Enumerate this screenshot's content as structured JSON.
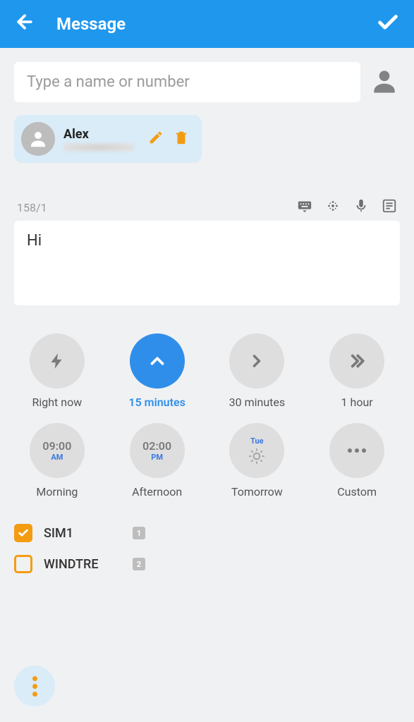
{
  "header": {
    "title": "Message"
  },
  "recipient": {
    "placeholder": "Type a name or number"
  },
  "contact": {
    "name": "Alex"
  },
  "message": {
    "counter": "158/1",
    "body": "Hi"
  },
  "schedule": [
    {
      "label": "Right now"
    },
    {
      "label": "15 minutes"
    },
    {
      "label": "30 minutes"
    },
    {
      "label": "1 hour"
    },
    {
      "time": "09:00",
      "period": "AM",
      "label": "Morning"
    },
    {
      "time": "02:00",
      "period": "PM",
      "label": "Afternoon"
    },
    {
      "day": "Tue",
      "label": "Tomorrow"
    },
    {
      "label": "Custom"
    }
  ],
  "sims": [
    {
      "name": "SIM1",
      "badge": "1",
      "checked": true
    },
    {
      "name": "WINDTRE",
      "badge": "2",
      "checked": false
    }
  ]
}
